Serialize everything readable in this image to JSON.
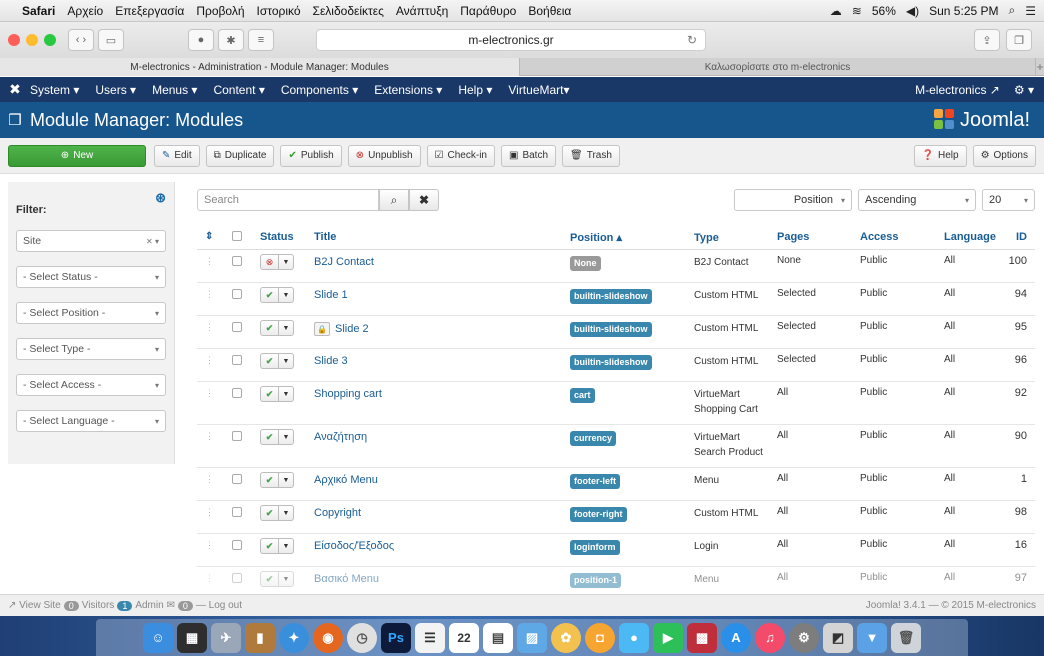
{
  "mac_menu": {
    "app": "Safari",
    "items": [
      "Αρχείο",
      "Επεξεργασία",
      "Προβολή",
      "Ιστορικό",
      "Σελιδοδείκτες",
      "Ανάπτυξη",
      "Παράθυρο",
      "Βοήθεια"
    ],
    "battery": "56%",
    "clock": "Sun 5:25 PM"
  },
  "browser": {
    "url": "m-electronics.gr",
    "tabs": [
      "M-electronics - Administration - Module Manager: Modules",
      "Καλωσορίσατε στο m-electronics"
    ]
  },
  "navbar": {
    "items": [
      "System ▾",
      "Users ▾",
      "Menus ▾",
      "Content ▾",
      "Components ▾",
      "Extensions ▾",
      "Help ▾",
      "VirtueMart▾"
    ],
    "site_link": "M-electronics ↗",
    "gear": "⚙ ▾"
  },
  "header": {
    "title": "Module Manager: Modules",
    "logo": "Joomla!"
  },
  "toolbar": {
    "new": "New",
    "edit": "Edit",
    "duplicate": "Duplicate",
    "publish": "Publish",
    "unpublish": "Unpublish",
    "checkin": "Check-in",
    "batch": "Batch",
    "trash": "Trash",
    "help": "Help",
    "options": "Options"
  },
  "filters": {
    "title": "Filter:",
    "site": "Site",
    "status": "- Select Status -",
    "position": "- Select Position -",
    "type": "- Select Type -",
    "access": "- Select Access -",
    "language": "- Select Language -"
  },
  "list_controls": {
    "search_placeholder": "Search",
    "sort_field": "Position",
    "sort_dir": "Ascending",
    "limit": "20"
  },
  "table": {
    "headers": {
      "status": "Status",
      "title": "Title",
      "position": "Position ▴",
      "type": "Type",
      "pages": "Pages",
      "access": "Access",
      "language": "Language",
      "id": "ID"
    },
    "rows": [
      {
        "title": "B2J Contact",
        "position": "None",
        "type": "B2J Contact",
        "type2": "",
        "pages": "None",
        "access": "Public",
        "language": "All",
        "id": "100",
        "published": false,
        "locked": false
      },
      {
        "title": "Slide 1",
        "position": "builtin-slideshow",
        "type": "Custom HTML",
        "type2": "",
        "pages": "Selected",
        "access": "Public",
        "language": "All",
        "id": "94",
        "published": true,
        "locked": false
      },
      {
        "title": "Slide 2",
        "position": "builtin-slideshow",
        "type": "Custom HTML",
        "type2": "",
        "pages": "Selected",
        "access": "Public",
        "language": "All",
        "id": "95",
        "published": true,
        "locked": true
      },
      {
        "title": "Slide 3",
        "position": "builtin-slideshow",
        "type": "Custom HTML",
        "type2": "",
        "pages": "Selected",
        "access": "Public",
        "language": "All",
        "id": "96",
        "published": true,
        "locked": false
      },
      {
        "title": "Shopping cart",
        "position": "cart",
        "type": "VirtueMart",
        "type2": "Shopping Cart",
        "pages": "All",
        "access": "Public",
        "language": "All",
        "id": "92",
        "published": true,
        "locked": false
      },
      {
        "title": "Αναζήτηση",
        "position": "currency",
        "type": "VirtueMart",
        "type2": "Search Product",
        "pages": "All",
        "access": "Public",
        "language": "All",
        "id": "90",
        "published": true,
        "locked": false
      },
      {
        "title": "Αρχικό Menu",
        "position": "footer-left",
        "type": "Menu",
        "type2": "",
        "pages": "All",
        "access": "Public",
        "language": "All",
        "id": "1",
        "published": true,
        "locked": false
      },
      {
        "title": "Copyright",
        "position": "footer-right",
        "type": "Custom HTML",
        "type2": "",
        "pages": "All",
        "access": "Public",
        "language": "All",
        "id": "98",
        "published": true,
        "locked": false
      },
      {
        "title": "Είσοδος/Έξοδος",
        "position": "loginform",
        "type": "Login",
        "type2": "",
        "pages": "All",
        "access": "Public",
        "language": "All",
        "id": "16",
        "published": true,
        "locked": false
      },
      {
        "title": "Βασικό Menu",
        "position": "position-1",
        "type": "Menu",
        "type2": "",
        "pages": "All",
        "access": "Public",
        "language": "All",
        "id": "97",
        "published": true,
        "locked": false
      }
    ]
  },
  "statusbar": {
    "view_site": "View Site",
    "visitors_count": "0",
    "visitors": "Visitors",
    "admin_count": "1",
    "admin": "Admin",
    "mail_count": "0",
    "logout": "Log out",
    "right": "Joomla! 3.4.1 — © 2015 M-electronics"
  },
  "dock": {
    "photoshop": "Ps",
    "calendar_day": "22"
  },
  "colors": {
    "navbar": "#1a3867",
    "header": "#17568c",
    "new_button": "#3a9a35",
    "badge": "#3a87ad",
    "link": "#1a5d94"
  }
}
